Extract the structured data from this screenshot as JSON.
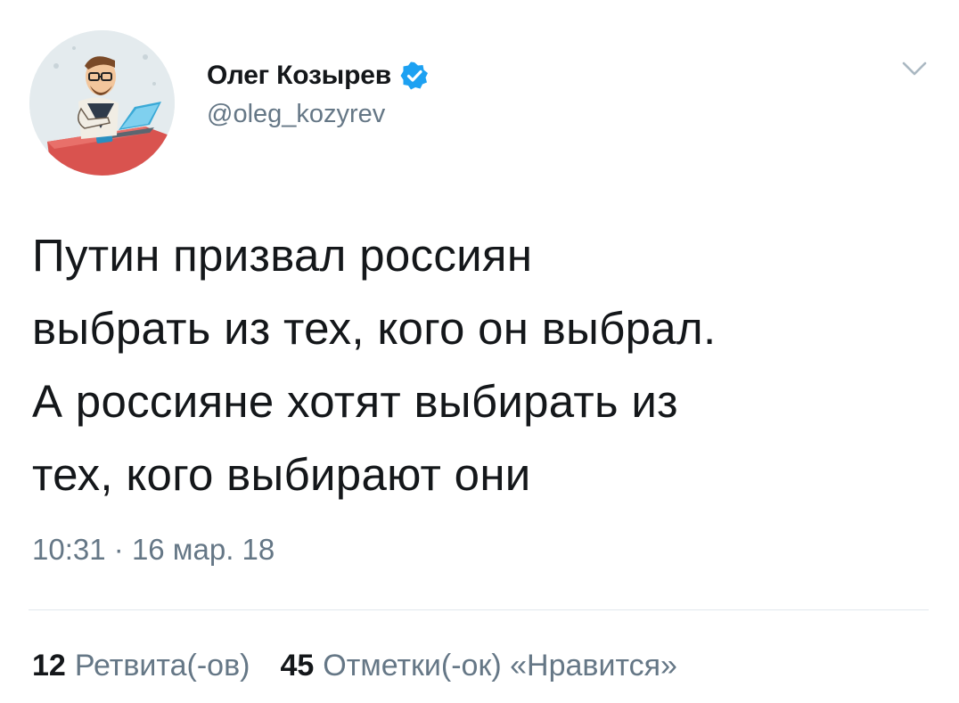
{
  "author": {
    "display_name": "Олег Козырев",
    "handle": "@oleg_kozyrev",
    "verified": true,
    "avatar_icon": "cartoon-man-at-desk-avatar",
    "verified_icon": "verified-badge-icon"
  },
  "menu_icon": "chevron-down-icon",
  "tweet": {
    "text": "Путин призвал россиян\nвыбрать из тех, кого он выбрал.\nА россияне хотят выбирать из\nтех, кого выбирают они",
    "time": "10:31",
    "separator": "·",
    "date": "16 мар. 18"
  },
  "stats": {
    "retweets_count": "12",
    "retweets_label": "Ретвита(-ов)",
    "likes_count": "45",
    "likes_label": "Отметки(-ок) «Нравится»"
  },
  "colors": {
    "text_primary": "#14171a",
    "text_secondary": "#657786",
    "verified_blue": "#1da1f2",
    "divider": "#e1e8ed"
  }
}
